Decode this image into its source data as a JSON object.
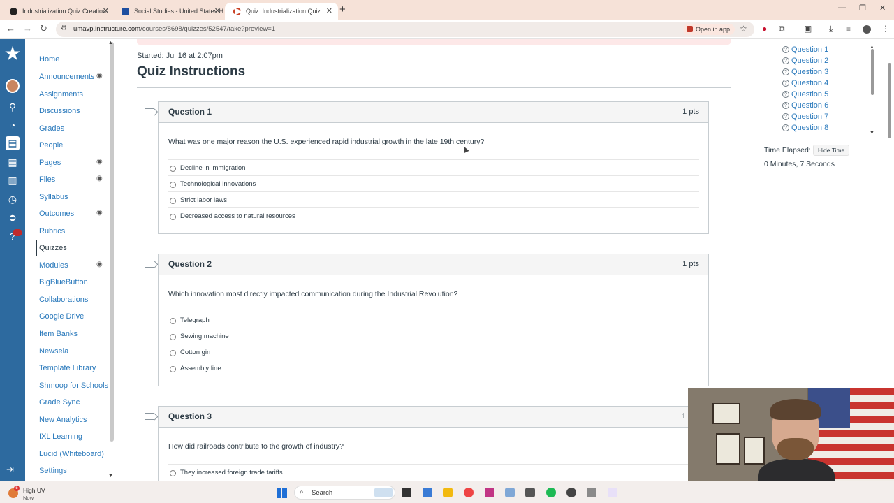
{
  "browser": {
    "tabs": [
      {
        "title": "Industrialization Quiz Creation",
        "favicon": "chatgpt-icon"
      },
      {
        "title": "Social Studies - United States H",
        "favicon": "umav-icon"
      },
      {
        "title": "Quiz: Industrialization Quiz",
        "favicon": "canvas-icon",
        "active": true
      }
    ],
    "url_domain": "umavp.instructure.com",
    "url_path": "/courses/8698/quizzes/52547/take?preview=1",
    "open_in_app": "Open in app"
  },
  "course_nav": {
    "items": [
      {
        "label": "Home",
        "hidden": false
      },
      {
        "label": "Announcements",
        "hidden": true
      },
      {
        "label": "Assignments",
        "hidden": false
      },
      {
        "label": "Discussions",
        "hidden": false
      },
      {
        "label": "Grades",
        "hidden": false
      },
      {
        "label": "People",
        "hidden": false
      },
      {
        "label": "Pages",
        "hidden": true
      },
      {
        "label": "Files",
        "hidden": true
      },
      {
        "label": "Syllabus",
        "hidden": false
      },
      {
        "label": "Outcomes",
        "hidden": true
      },
      {
        "label": "Rubrics",
        "hidden": false
      },
      {
        "label": "Quizzes",
        "hidden": false,
        "active": true
      },
      {
        "label": "Modules",
        "hidden": true
      },
      {
        "label": "BigBlueButton",
        "hidden": false
      },
      {
        "label": "Collaborations",
        "hidden": false
      },
      {
        "label": "Google Drive",
        "hidden": false
      },
      {
        "label": "Item Banks",
        "hidden": false
      },
      {
        "label": "Newsela",
        "hidden": false
      },
      {
        "label": "Template Library",
        "hidden": false
      },
      {
        "label": "Shmoop for Schools",
        "hidden": false
      },
      {
        "label": "Grade Sync",
        "hidden": false
      },
      {
        "label": "New Analytics",
        "hidden": false
      },
      {
        "label": "IXL Learning",
        "hidden": false
      },
      {
        "label": "Lucid (Whiteboard)",
        "hidden": false
      },
      {
        "label": "Settings",
        "hidden": false
      }
    ]
  },
  "quiz": {
    "started": "Started: Jul 16 at 2:07pm",
    "title": "Quiz Instructions",
    "questions": [
      {
        "name": "Question 1",
        "points": "1 pts",
        "text": "What was one major reason the U.S. experienced rapid industrial growth in the late 19th century?",
        "answers": [
          "Decline in immigration",
          "Technological innovations",
          "Strict labor laws",
          "Decreased access to natural resources"
        ]
      },
      {
        "name": "Question 2",
        "points": "1 pts",
        "text": "Which innovation most directly impacted communication during the Industrial Revolution?",
        "answers": [
          "Telegraph",
          "Sewing machine",
          "Cotton gin",
          "Assembly line"
        ]
      },
      {
        "name": "Question 3",
        "points": "1",
        "text": "How did railroads contribute to the growth of industry?",
        "answers": [
          "They increased foreign trade tariffs"
        ]
      }
    ]
  },
  "sidebar": {
    "question_links": [
      "Question 1",
      "Question 2",
      "Question 3",
      "Question 4",
      "Question 5",
      "Question 6",
      "Question 7",
      "Question 8"
    ],
    "time_elapsed_label": "Time Elapsed:",
    "hide_time_label": "Hide Time",
    "time_elapsed_value": "0 Minutes, 7 Seconds"
  },
  "taskbar": {
    "weather_title": "High UV",
    "weather_sub": "Now",
    "weather_badge": "5",
    "search_label": "Search"
  },
  "colors": {
    "link": "#2b7abc",
    "global_nav": "#2d6a9f",
    "text": "#2d3b45"
  }
}
